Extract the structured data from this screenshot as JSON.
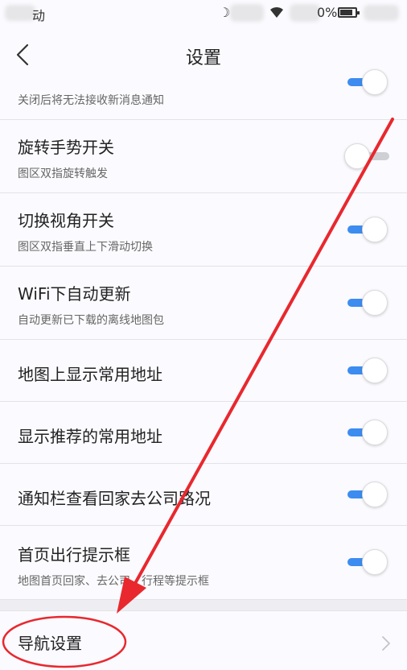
{
  "status_bar": {
    "battery_suffix": "0%",
    "left_fragment": "动"
  },
  "header": {
    "title": "设置"
  },
  "settings": [
    {
      "id": "notify",
      "title": "",
      "subtitle": "关闭后将无法接收新消息通知",
      "enabled": true
    },
    {
      "id": "rotate-gesture",
      "title": "旋转手势开关",
      "subtitle": "图区双指旋转触发",
      "enabled": false
    },
    {
      "id": "switch-view",
      "title": "切换视角开关",
      "subtitle": "图区双指垂直上下滑动切换",
      "enabled": true
    },
    {
      "id": "wifi-auto-update",
      "title": "WiFi下自动更新",
      "subtitle": "自动更新已下载的离线地图包",
      "enabled": true
    },
    {
      "id": "show-common-address",
      "title": "地图上显示常用地址",
      "subtitle": "",
      "enabled": true
    },
    {
      "id": "recommend-common-address",
      "title": "显示推荐的常用地址",
      "subtitle": "",
      "enabled": true
    },
    {
      "id": "notification-route",
      "title": "通知栏查看回家去公司路况",
      "subtitle": "",
      "enabled": true
    },
    {
      "id": "home-travel-tip",
      "title": "首页出行提示框",
      "subtitle": "地图首页回家、去公司、行程等提示框",
      "enabled": true
    }
  ],
  "navigation": {
    "label": "导航设置"
  },
  "colors": {
    "accent": "#3d8cf0",
    "annotation": "#e8282e",
    "background": "#fbfafe"
  }
}
